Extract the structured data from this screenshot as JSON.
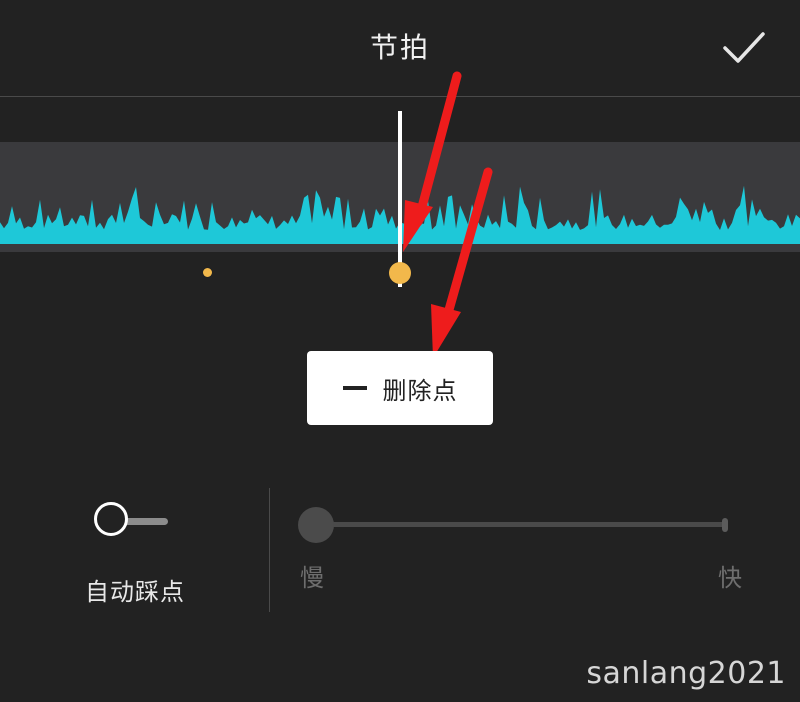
{
  "header": {
    "title": "节拍",
    "confirm_icon": "checkmark-icon"
  },
  "timeline": {
    "waveform_color": "#1ec8d8",
    "background_color": "#3a3a3d",
    "playhead_color": "#ffffff",
    "beat_marker_color": "#f2b84b",
    "beat_marker_count": 2
  },
  "action": {
    "delete_icon": "minus-icon",
    "delete_label": "删除点"
  },
  "auto_beat": {
    "label": "自动踩点",
    "enabled": false
  },
  "speed": {
    "slow_label": "慢",
    "fast_label": "快",
    "value": 0
  },
  "annotation": {
    "arrow_color": "#ee1c1c",
    "arrow_count": 2
  },
  "watermark": "sanlang2021"
}
